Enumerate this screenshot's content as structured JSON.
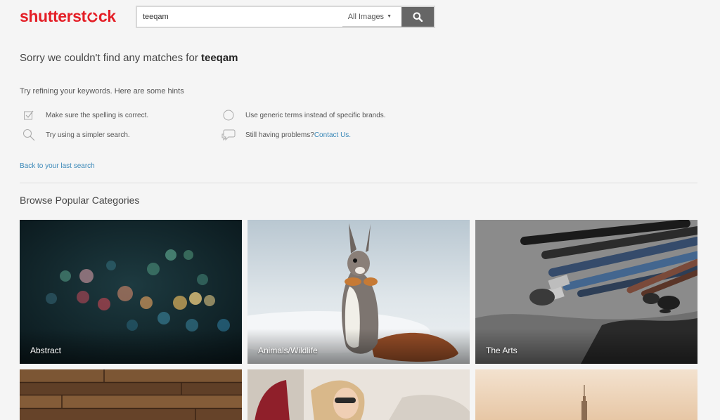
{
  "header": {
    "logo_text_pre": "shutterst",
    "logo_text_post": "ck",
    "search": {
      "value": "teeqam",
      "placeholder": "",
      "type_label": "All Images"
    }
  },
  "message": {
    "prefix": "Sorry we couldn't find any matches for ",
    "query": "teeqam"
  },
  "hints": {
    "title": "Try refining your keywords. Here are some hints",
    "items": [
      {
        "text": "Make sure the spelling is correct.",
        "icon": "checkbox-icon"
      },
      {
        "text": "Use generic terms instead of specific brands.",
        "icon": "circle-icon"
      },
      {
        "text": "Try using a simpler search.",
        "icon": "search-icon"
      },
      {
        "text": "Still having problems? ",
        "link": "Contact Us.",
        "icon": "chat-bubble-icon"
      }
    ]
  },
  "back_link": "Back to your last search",
  "browse": {
    "title": "Browse Popular Categories",
    "categories": [
      {
        "label": "Abstract"
      },
      {
        "label": "Animals/Wildlife"
      },
      {
        "label": "The Arts"
      },
      {
        "label": ""
      },
      {
        "label": ""
      },
      {
        "label": ""
      }
    ]
  },
  "colors": {
    "brand": "#e41e26",
    "link": "#3a88b8",
    "search_button": "#666666"
  }
}
